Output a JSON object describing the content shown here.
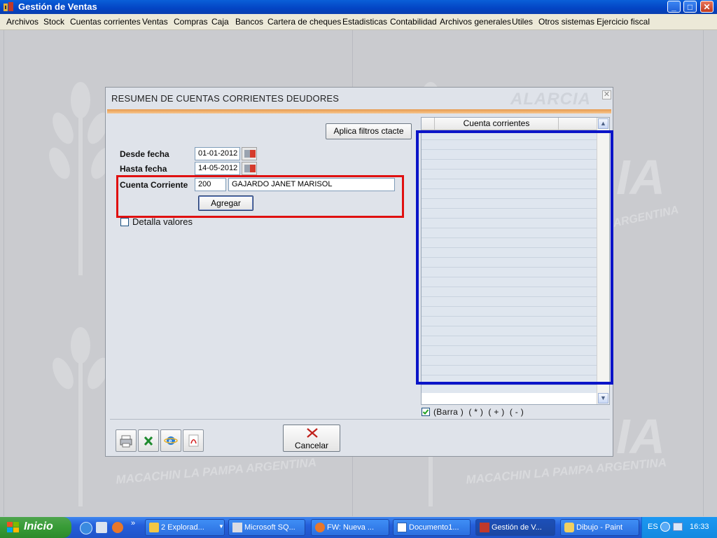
{
  "window": {
    "title": "Gestión de Ventas",
    "icon": "app-icon"
  },
  "menu": {
    "items": [
      "Archivos",
      "Stock",
      "Cuentas corrientes",
      "Ventas",
      "Compras",
      "Caja",
      "Bancos",
      "Cartera de cheques",
      "Estadisticas",
      "Contabilidad",
      "Archivos generales",
      "Utiles",
      "Otros sistemas",
      "Ejercicio fiscal"
    ]
  },
  "watermark": {
    "brand_fragment": "IA",
    "line": "MACACHIN LA PAMPA ARGENTINA",
    "argentina": "ARGENTINA"
  },
  "dialog": {
    "title": "RESUMEN DE CUENTAS CORRIENTES DEUDORES",
    "logo": "ALARCIA",
    "apply_filters_label": "Aplica filtros ctacte",
    "desde_label": "Desde fecha",
    "desde_value": "01-01-2012",
    "hasta_label": "Hasta fecha",
    "hasta_value": "14-05-2012",
    "cuenta_label": "Cuenta Corriente",
    "cuenta_code": "200",
    "cuenta_name": "GAJARDO JANET MARISOL",
    "agregar_label": "Agregar",
    "detalla_label": "Detalla valores",
    "grid_header": "Cuenta corrientes",
    "barra_label": "(Barra )  ( * )  ( + )  ( - )",
    "cancel_label": "Cancelar",
    "bottom_icons": [
      "printer-icon",
      "excel-icon",
      "browser-icon",
      "pdf-icon"
    ]
  },
  "taskbar": {
    "start_label": "Inicio",
    "tasks": [
      {
        "label": "2 Explorad...",
        "icon": "folder-icon"
      },
      {
        "label": "Microsoft SQ...",
        "icon": "sql-icon"
      },
      {
        "label": "FW: Nueva ...",
        "icon": "firefox-icon"
      },
      {
        "label": "Documento1...",
        "icon": "word-icon"
      },
      {
        "label": "Gestión de V...",
        "icon": "app-icon"
      },
      {
        "label": "Dibujo - Paint",
        "icon": "paint-icon"
      }
    ],
    "lang": "ES",
    "time": "16:33"
  },
  "colors": {
    "highlight_red": "#e01010",
    "highlight_blue": "#0a14c8",
    "title_bar": "#0344c4",
    "dialog_accent": "#e79b4f"
  }
}
